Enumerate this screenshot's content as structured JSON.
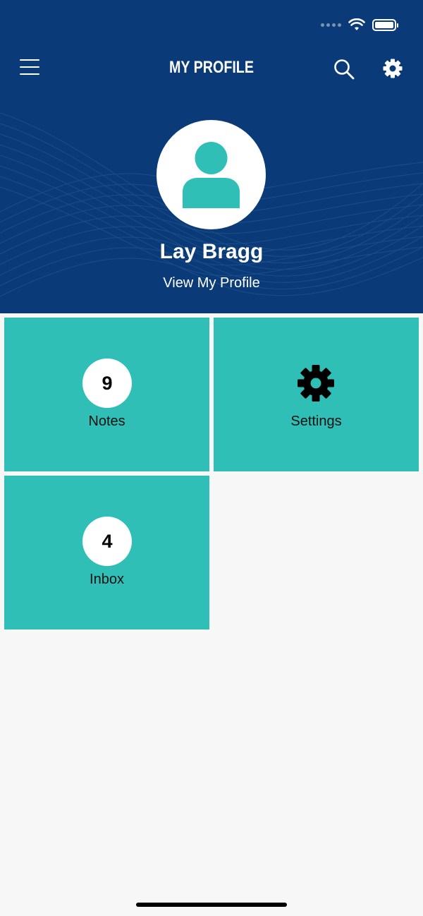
{
  "header": {
    "title": "MY PROFILE",
    "menu_icon": "hamburger-menu-icon",
    "search_icon": "search-icon",
    "settings_icon": "gear-icon"
  },
  "profile": {
    "name": "Lay Bragg",
    "link_label": "View My Profile",
    "avatar_icon": "user-avatar-icon"
  },
  "tiles": [
    {
      "label": "Notes",
      "count": "9"
    },
    {
      "label": "Settings",
      "icon": "gear-icon"
    },
    {
      "label": "Inbox",
      "count": "4"
    }
  ],
  "colors": {
    "header_bg": "#0a3b78",
    "tile_bg": "#2fbfb6",
    "page_bg": "#f7f7f7"
  }
}
